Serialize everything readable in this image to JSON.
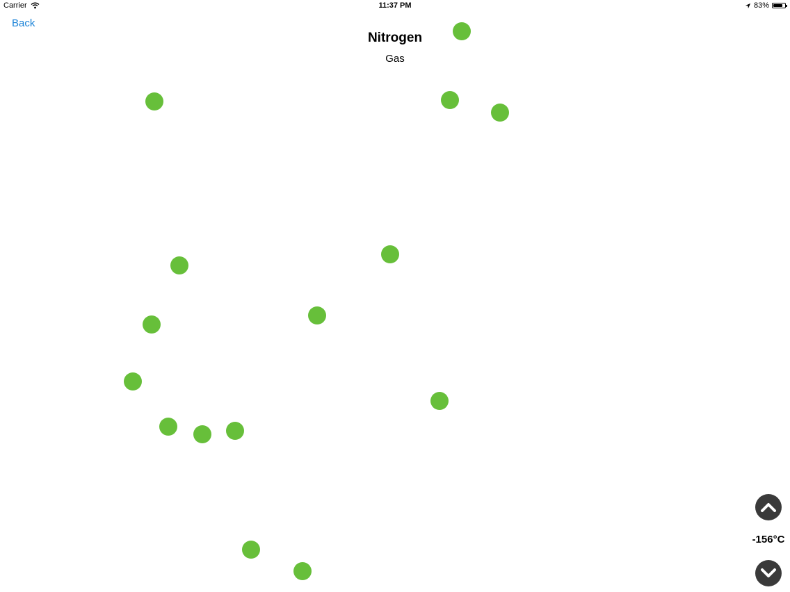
{
  "status_bar": {
    "carrier": "Carrier",
    "time": "11:37 PM",
    "battery": "83%",
    "battery_level": 0.83
  },
  "nav": {
    "back_label": "Back"
  },
  "element": {
    "name": "Nitrogen",
    "state": "Gas"
  },
  "controls": {
    "temperature": "-156°C",
    "increase_icon": "chevron-up-icon",
    "decrease_icon": "chevron-down-icon"
  },
  "colors": {
    "particle": "#67bf3a",
    "link": "#1a82d7",
    "control": "#3a3a3a"
  },
  "particle_count": 16
}
